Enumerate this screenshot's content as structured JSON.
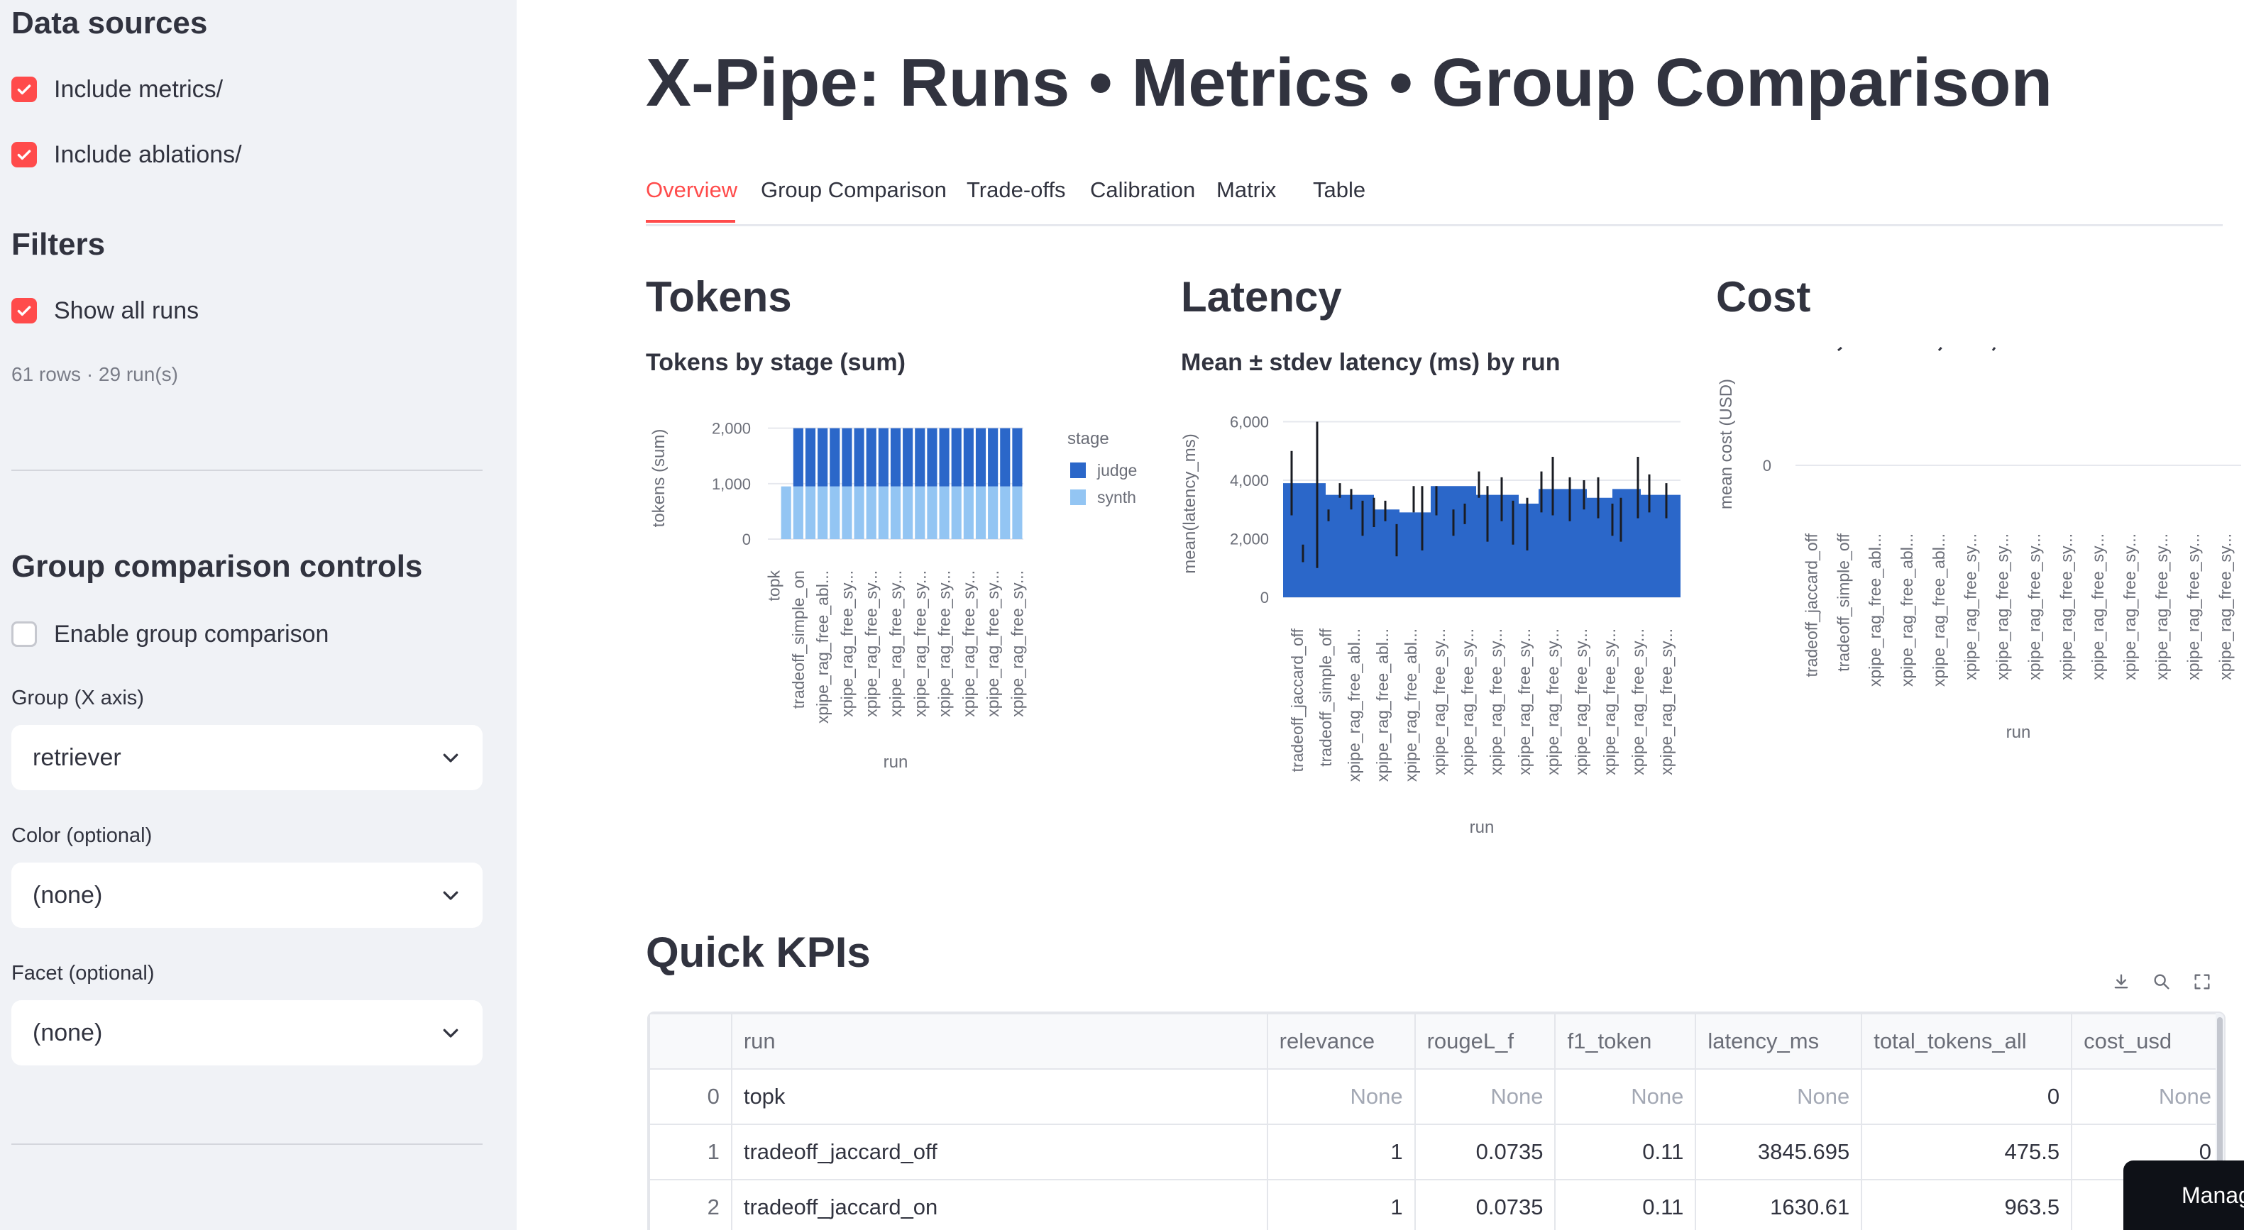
{
  "sidebar": {
    "data_sources_heading": "Data sources",
    "include_metrics": {
      "label": "Include metrics/",
      "checked": true
    },
    "include_ablations": {
      "label": "Include ablations/",
      "checked": true
    },
    "filters_heading": "Filters",
    "show_all_runs": {
      "label": "Show all runs",
      "checked": true
    },
    "summary": "61 rows · 29 run(s)",
    "group_controls_heading": "Group comparison controls",
    "enable_group": {
      "label": "Enable group comparison",
      "checked": false
    },
    "group_label": "Group (X axis)",
    "group_value": "retriever",
    "color_label": "Color (optional)",
    "color_value": "(none)",
    "facet_label": "Facet (optional)",
    "facet_value": "(none)"
  },
  "main": {
    "title": "X-Pipe: Runs • Metrics • Group Comparison",
    "tabs": [
      "Overview",
      "Group Comparison",
      "Trade-offs",
      "Calibration",
      "Matrix",
      "Table"
    ],
    "active_tab": "Overview",
    "tokens_heading": "Tokens",
    "latency_heading": "Latency",
    "cost_heading": "Cost",
    "kpi_heading": "Quick KPIs"
  },
  "chart_data": [
    {
      "type": "bar",
      "stacked": true,
      "title": "Tokens by stage (sum)",
      "xlabel": "run",
      "ylabel": "tokens (sum)",
      "ylim": [
        0,
        2200
      ],
      "yticks": [
        0,
        1000,
        2000
      ],
      "grid": true,
      "legend_title": "stage",
      "legend_position": "right",
      "categories": [
        "topk",
        "",
        "tradeoff_simple_on",
        "",
        "xpipe_rag_free_abl...",
        "",
        "xpipe_rag_free_sy...",
        "",
        "xpipe_rag_free_sy...",
        "",
        "xpipe_rag_free_sy...",
        "",
        "xpipe_rag_free_sy...",
        "",
        "xpipe_rag_free_sy...",
        "",
        "xpipe_rag_free_sy...",
        "",
        "xpipe_rag_free_sy...",
        "",
        "xpipe_rag_free_sy..."
      ],
      "series": [
        {
          "name": "judge",
          "color": "#2b67c9",
          "values": [
            0,
            0,
            1050,
            1050,
            1050,
            1050,
            1050,
            1050,
            1050,
            1050,
            1050,
            1050,
            1050,
            1050,
            1050,
            1050,
            1050,
            1050,
            1050,
            1050,
            1050
          ]
        },
        {
          "name": "synth",
          "color": "#93c5f3",
          "values": [
            0,
            950,
            950,
            950,
            950,
            950,
            950,
            950,
            950,
            950,
            950,
            950,
            950,
            950,
            950,
            950,
            950,
            950,
            950,
            950,
            950
          ]
        }
      ]
    },
    {
      "type": "bar",
      "error_bars": true,
      "title": "Mean ± stdev latency (ms) by run",
      "xlabel": "run",
      "ylabel": "mean(latency_ms)",
      "ylim": [
        0,
        6400
      ],
      "yticks": [
        0,
        2000,
        4000,
        6000
      ],
      "grid": true,
      "color": "#2b67c9",
      "categories": [
        "tradeoff_jaccard_off",
        "tradeoff_simple_off",
        "xpipe_rag_free_abl...",
        "xpipe_rag_free_abl...",
        "xpipe_rag_free_abl...",
        "xpipe_rag_free_sy...",
        "xpipe_rag_free_sy...",
        "xpipe_rag_free_sy...",
        "xpipe_rag_free_sy...",
        "xpipe_rag_free_sy...",
        "xpipe_rag_free_sy...",
        "xpipe_rag_free_sy...",
        "xpipe_rag_free_sy...",
        "xpipe_rag_free_sy..."
      ],
      "values": [
        3900,
        3900,
        3500,
        3500,
        2900,
        3800,
        3800,
        3500,
        3500,
        3700,
        3700,
        3400,
        3700,
        3500
      ],
      "bars": [
        {
          "start": 0.0,
          "end": 1.5,
          "value": 3900
        },
        {
          "start": 1.5,
          "end": 3.2,
          "value": 3500
        },
        {
          "start": 3.2,
          "end": 4.1,
          "value": 3000
        },
        {
          "start": 4.1,
          "end": 5.2,
          "value": 2900
        },
        {
          "start": 5.2,
          "end": 6.8,
          "value": 3800
        },
        {
          "start": 6.8,
          "end": 8.3,
          "value": 3500
        },
        {
          "start": 8.3,
          "end": 9.0,
          "value": 3200
        },
        {
          "start": 9.0,
          "end": 10.7,
          "value": 3700
        },
        {
          "start": 10.7,
          "end": 11.6,
          "value": 3400
        },
        {
          "start": 11.6,
          "end": 12.6,
          "value": 3700
        },
        {
          "start": 12.6,
          "end": 14.0,
          "value": 3500
        }
      ],
      "errors": [
        {
          "x": 0.3,
          "low": 2800,
          "high": 5000
        },
        {
          "x": 0.7,
          "low": 1200,
          "high": 1800
        },
        {
          "x": 1.2,
          "low": 1000,
          "high": 6000
        },
        {
          "x": 1.6,
          "low": 2600,
          "high": 3000
        },
        {
          "x": 2.0,
          "low": 3400,
          "high": 3900
        },
        {
          "x": 2.4,
          "low": 3000,
          "high": 3700
        },
        {
          "x": 2.8,
          "low": 2100,
          "high": 3300
        },
        {
          "x": 3.2,
          "low": 2400,
          "high": 3400
        },
        {
          "x": 3.6,
          "low": 2600,
          "high": 3300
        },
        {
          "x": 4.0,
          "low": 1400,
          "high": 2500
        },
        {
          "x": 4.6,
          "low": 2900,
          "high": 3800
        },
        {
          "x": 4.9,
          "low": 1600,
          "high": 3800
        },
        {
          "x": 5.4,
          "low": 2800,
          "high": 3800
        },
        {
          "x": 6.0,
          "low": 2100,
          "high": 3000
        },
        {
          "x": 6.4,
          "low": 2500,
          "high": 3200
        },
        {
          "x": 6.9,
          "low": 3400,
          "high": 4300
        },
        {
          "x": 7.2,
          "low": 1900,
          "high": 3800
        },
        {
          "x": 7.7,
          "low": 2600,
          "high": 4100
        },
        {
          "x": 8.1,
          "low": 1800,
          "high": 3300
        },
        {
          "x": 8.6,
          "low": 1600,
          "high": 3400
        },
        {
          "x": 9.1,
          "low": 2900,
          "high": 4300
        },
        {
          "x": 9.5,
          "low": 2800,
          "high": 4800
        },
        {
          "x": 10.1,
          "low": 2600,
          "high": 4100
        },
        {
          "x": 10.6,
          "low": 3000,
          "high": 4000
        },
        {
          "x": 11.1,
          "low": 2700,
          "high": 4100
        },
        {
          "x": 11.6,
          "low": 2100,
          "high": 3200
        },
        {
          "x": 11.9,
          "low": 1900,
          "high": 3400
        },
        {
          "x": 12.5,
          "low": 2700,
          "high": 4800
        },
        {
          "x": 12.9,
          "low": 2900,
          "high": 4200
        },
        {
          "x": 13.5,
          "low": 2700,
          "high": 3900
        }
      ]
    },
    {
      "type": "bar",
      "title": "",
      "xlabel": "run",
      "ylabel": "mean cost (USD)",
      "yticks": [
        0
      ],
      "grid": true,
      "categories": [
        "tradeoff_jaccard_off",
        "tradeoff_simple_off",
        "xpipe_rag_free_abl...",
        "xpipe_rag_free_abl...",
        "xpipe_rag_free_abl...",
        "xpipe_rag_free_sy...",
        "xpipe_rag_free_sy...",
        "xpipe_rag_free_sy...",
        "xpipe_rag_free_sy...",
        "xpipe_rag_free_sy...",
        "xpipe_rag_free_sy...",
        "xpipe_rag_free_sy...",
        "xpipe_rag_free_sy...",
        "xpipe_rag_free_sy..."
      ],
      "values": [
        0,
        0,
        0,
        0,
        0,
        0,
        0,
        0,
        0,
        0,
        0,
        0,
        0,
        0
      ]
    }
  ],
  "kpi_table": {
    "columns": [
      "run",
      "relevance",
      "rougeL_f",
      "f1_token",
      "latency_ms",
      "total_tokens_all",
      "cost_usd"
    ],
    "rows": [
      [
        "0",
        "topk",
        "None",
        "None",
        "None",
        "None",
        "0",
        "None"
      ],
      [
        "1",
        "tradeoff_jaccard_off",
        "1",
        "0.0735",
        "0.11",
        "3845.695",
        "475.5",
        "0"
      ],
      [
        "2",
        "tradeoff_jaccard_on",
        "1",
        "0.0735",
        "0.11",
        "1630.61",
        "963.5",
        ""
      ]
    ]
  },
  "corner_button": {
    "label": "Manage app"
  },
  "colors": {
    "accent": "#ff4b4b",
    "bar_dark": "#2b67c9",
    "bar_light": "#93c5f3"
  }
}
